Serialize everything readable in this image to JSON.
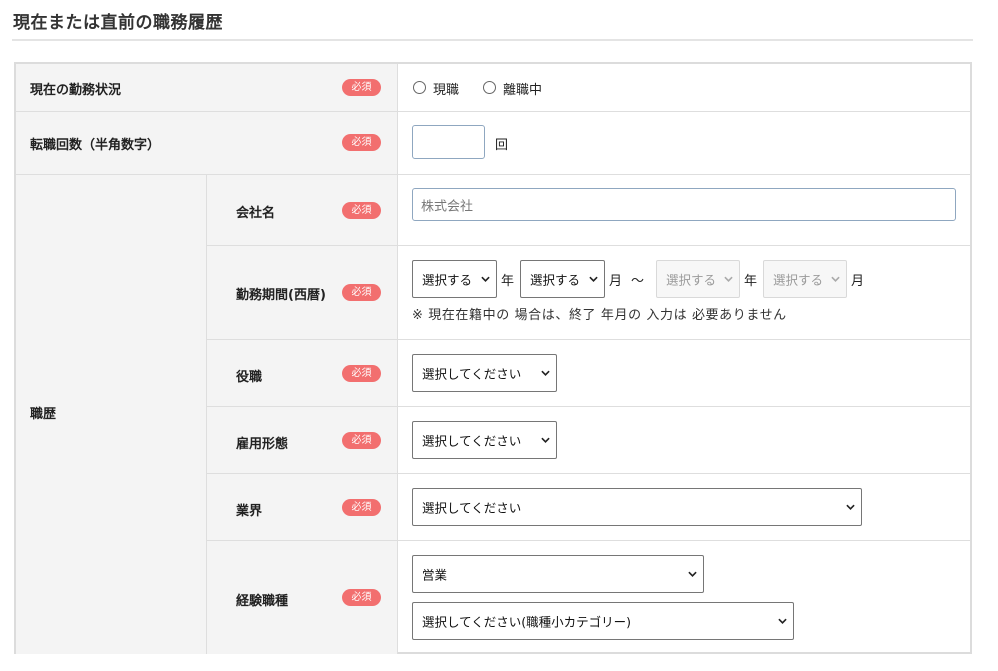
{
  "section_title": "現在または直前の職務履歴",
  "required_badge": "必須",
  "employment_status": {
    "label": "現在の勤務状況",
    "options": [
      "現職",
      "離職中"
    ]
  },
  "job_changes": {
    "label": "転職回数（半角数字）",
    "value": "",
    "unit": "回"
  },
  "career": {
    "label": "職歴",
    "company": {
      "label": "会社名",
      "placeholder": "株式会社"
    },
    "period": {
      "label": "勤務期間(西暦)",
      "start_year": "選択する",
      "year_unit": "年",
      "start_month": "選択する",
      "month_unit": "月",
      "tilde": "～",
      "end_year": "選択する",
      "end_month": "選択する",
      "note": "※ 現在在籍中の 場合は、終了 年月の 入力は 必要ありません"
    },
    "position": {
      "label": "役職",
      "selected": "選択してください"
    },
    "employment_type": {
      "label": "雇用形態",
      "selected": "選択してください"
    },
    "industry": {
      "label": "業界",
      "selected": "選択してください"
    },
    "occupation": {
      "label": "経験職種",
      "major": "営業",
      "minor": "選択してください(職種小カテゴリー)"
    }
  }
}
